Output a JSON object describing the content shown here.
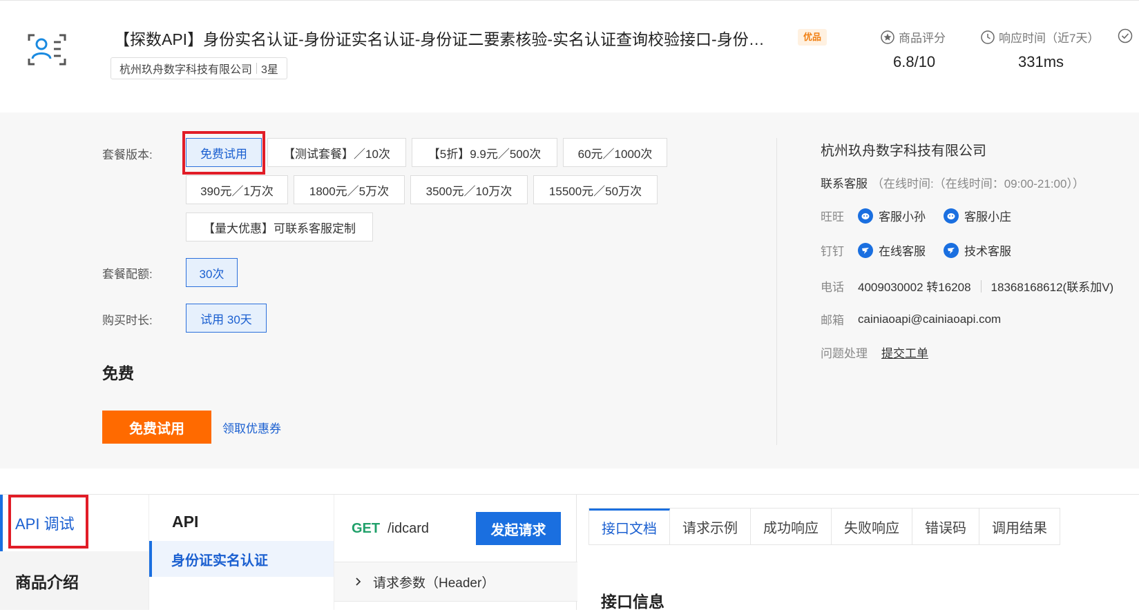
{
  "header": {
    "title": "【探数API】身份实名认证-身份证实名认证-身份证二要素核验-实名认证查询校验接口-身份…",
    "badge": "优品",
    "company": "杭州玖舟数字科技有限公司",
    "stars": "3星",
    "metrics": [
      {
        "label": "商品评分",
        "value": "6.8/10",
        "icon": "star-circle-icon"
      },
      {
        "label": "响应时间（近7天）",
        "value": "331ms",
        "icon": "clock-icon"
      }
    ]
  },
  "package": {
    "version_label": "套餐版本:",
    "options": [
      "免费试用",
      "【测试套餐】／10次",
      "【5折】9.9元／500次",
      "60元／1000次",
      "390元／1万次",
      "1800元／5万次",
      "3500元／10万次",
      "15500元／50万次",
      "【量大优惠】可联系客服定制"
    ],
    "selected_option": "免费试用",
    "quota_label": "套餐配额:",
    "quota_value": "30次",
    "duration_label": "购买时长:",
    "duration_value": "试用 30天",
    "price": "免费",
    "trial_button": "免费试用",
    "coupon_link": "领取优惠券"
  },
  "contact": {
    "company": "杭州玖舟数字科技有限公司",
    "service_label": "联系客服",
    "service_hours": "（在线时间:（在线时间：09:00-21:00））",
    "wangwang_label": "旺旺",
    "wangwang_contacts": [
      "客服小孙",
      "客服小庄"
    ],
    "dingding_label": "钉钉",
    "dingding_contacts": [
      "在线客服",
      "技术客服"
    ],
    "phone_label": "电话",
    "phone1": "4009030002 转16208",
    "phone2": "18368168612(联系加V)",
    "email_label": "邮箱",
    "email": "cainiaoapi@cainiaoapi.com",
    "issue_label": "问题处理",
    "issue_link": "提交工单"
  },
  "bottom": {
    "side_api": "API 调试",
    "side_intro": "商品介绍",
    "api_heading": "API",
    "api_item": "身份证实名认证",
    "method": "GET",
    "path": "/idcard",
    "send_button": "发起请求",
    "req_params": "请求参数（Header）",
    "tabs": [
      "接口文档",
      "请求示例",
      "成功响应",
      "失败响应",
      "错误码",
      "调用结果"
    ],
    "doc_heading": "接口信息"
  }
}
